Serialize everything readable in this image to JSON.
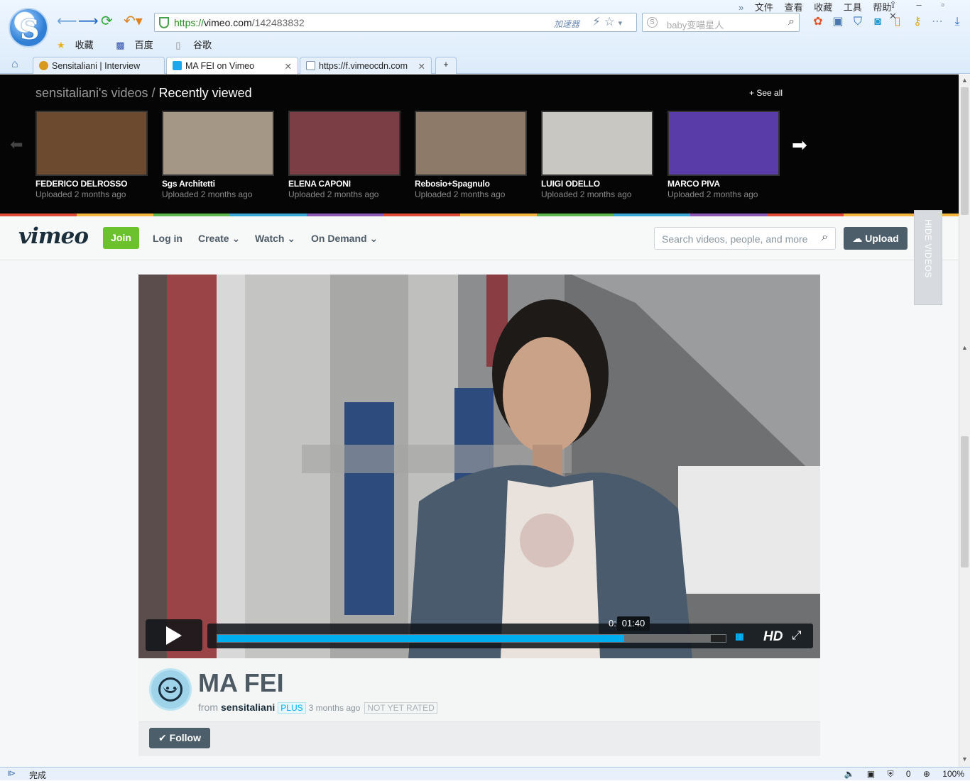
{
  "browser": {
    "menu": [
      "文件",
      "查看",
      "收藏",
      "工具",
      "帮助"
    ],
    "window_controls": "⇧ – ▫ ✕",
    "url_host": "https://",
    "url_domain": "vimeo.com",
    "url_path": "/142483832",
    "accelerator": "加速器",
    "search_placeholder": "baby变喵星人",
    "bookmarks": [
      "收藏",
      "百度",
      "谷歌"
    ],
    "tabs": [
      {
        "label": "Sensitaliani | Interview",
        "color": "#d79a1c"
      },
      {
        "label": "MA FEI on Vimeo",
        "color": "#1aa7ec"
      },
      {
        "label": "https://f.vimeocdn.com",
        "color": "#7a8fa8"
      }
    ],
    "new_tab": "+",
    "status_left": "完成",
    "status_count": "0",
    "zoom": "100%"
  },
  "recently": {
    "owner": "sensitaliani's videos",
    "separator": " / ",
    "section": "Recently viewed",
    "see_all": "+ See all",
    "videos": [
      {
        "title": "FEDERICO DELROSSO",
        "uploaded": "Uploaded 2 months ago",
        "bg": "#6b4a30"
      },
      {
        "title": "Sgs Architetti",
        "uploaded": "Uploaded 2 months ago",
        "bg": "#a49786"
      },
      {
        "title": "ELENA CAPONI",
        "uploaded": "Uploaded 2 months ago",
        "bg": "#7b3e44"
      },
      {
        "title": "Rebosio+Spagnulo",
        "uploaded": "Uploaded 2 months ago",
        "bg": "#8e7a68"
      },
      {
        "title": "LUIGI ODELLO",
        "uploaded": "Uploaded 2 months ago",
        "bg": "#c8c7c2"
      },
      {
        "title": "MARCO PIVA",
        "uploaded": "Uploaded 2 months ago",
        "bg": "#5a3ca8"
      }
    ]
  },
  "vimeo_nav": {
    "logo": "vimeo",
    "join": "Join",
    "login": "Log in",
    "create": "Create",
    "watch": "Watch",
    "on_demand": "On Demand",
    "search_placeholder": "Search videos, people, and more",
    "upload": "Upload",
    "hide_videos": "HIDE VIDEOS"
  },
  "player": {
    "time_prefix": "0:",
    "time_tooltip": "01:40",
    "progress_played": 0.8,
    "progress_loaded": 0.97,
    "volume_bars": "IIIII",
    "hd": "HD",
    "fullscreen": "⤢"
  },
  "video": {
    "title": "MA FEI",
    "from": "from",
    "owner": "sensitaliani",
    "plus": "PLUS",
    "ago": "3 months ago",
    "rating": "NOT YET RATED",
    "follow": "Follow"
  },
  "colors": {
    "accent": "#00adef",
    "join": "#6cc22c",
    "nav_dark": "#4d5e6b"
  }
}
